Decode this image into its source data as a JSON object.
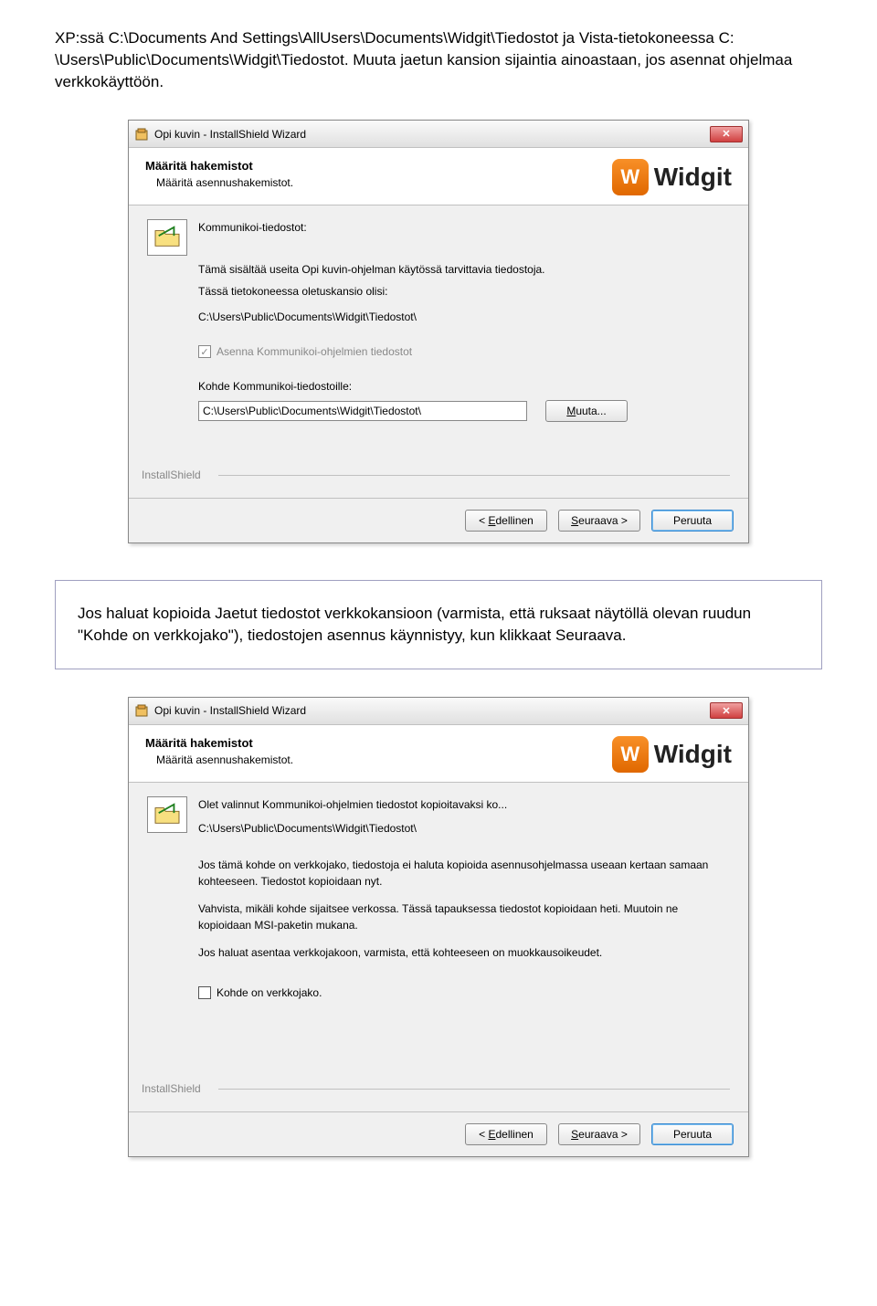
{
  "intro": "XP:ssä C:\\Documents And Settings\\AllUsers\\Documents\\Widgit\\Tiedostot ja Vista-tietokoneessa C: \\Users\\Public\\Documents\\Widgit\\Tiedostot. Muuta jaetun kansion sijaintia ainoastaan, jos asennat ohjelmaa verkkokäyttöön.",
  "logo_text": "Widgit",
  "dialog1": {
    "title": "Opi kuvin - InstallShield Wizard",
    "header_title": "Määritä hakemistot",
    "header_sub": "Määritä asennushakemistot.",
    "files_label": "Kommunikoi-tiedostot:",
    "desc1": "Tämä sisältää useita Opi kuvin-ohjelman käytössä tarvittavia tiedostoja.",
    "desc2": "Tässä tietokoneessa oletuskansio olisi:",
    "path": "C:\\Users\\Public\\Documents\\Widgit\\Tiedostot\\",
    "chk_label": "Asenna Kommunikoi-ohjelmien tiedostot",
    "dest_label": "Kohde Kommunikoi-tiedostoille:",
    "dest_value": "C:\\Users\\Public\\Documents\\Widgit\\Tiedostot\\",
    "change_btn": "Muuta...",
    "installshield": "InstallShield",
    "back": "Edellinen",
    "next": "Seuraava >",
    "cancel": "Peruuta"
  },
  "mid_text": "Jos haluat kopioida Jaetut tiedostot verkkokansioon (varmista, että ruksaat näytöllä olevan ruudun \"Kohde on verkkojako\"), tiedostojen asennus käynnistyy, kun klikkaat Seuraava.",
  "dialog2": {
    "title": "Opi kuvin - InstallShield Wizard",
    "header_title": "Määritä hakemistot",
    "header_sub": "Määritä asennushakemistot.",
    "line1": "Olet valinnut Kommunikoi-ohjelmien tiedostot kopioitavaksi ko...",
    "path": "C:\\Users\\Public\\Documents\\Widgit\\Tiedostot\\",
    "p1": "Jos tämä kohde on verkkojako, tiedostoja ei haluta kopioida asennusohjelmassa useaan kertaan samaan kohteeseen. Tiedostot kopioidaan nyt.",
    "p2": "Vahvista, mikäli kohde sijaitsee verkossa. Tässä tapauksessa tiedostot kopioidaan heti. Muutoin ne kopioidaan MSI-paketin mukana.",
    "p3": "Jos haluat asentaa verkkojakoon, varmista, että kohteeseen on muokkausoikeudet.",
    "chk_label": "Kohde on verkkojako.",
    "installshield": "InstallShield",
    "back": "Edellinen",
    "next": "Seuraava >",
    "cancel": "Peruuta"
  }
}
